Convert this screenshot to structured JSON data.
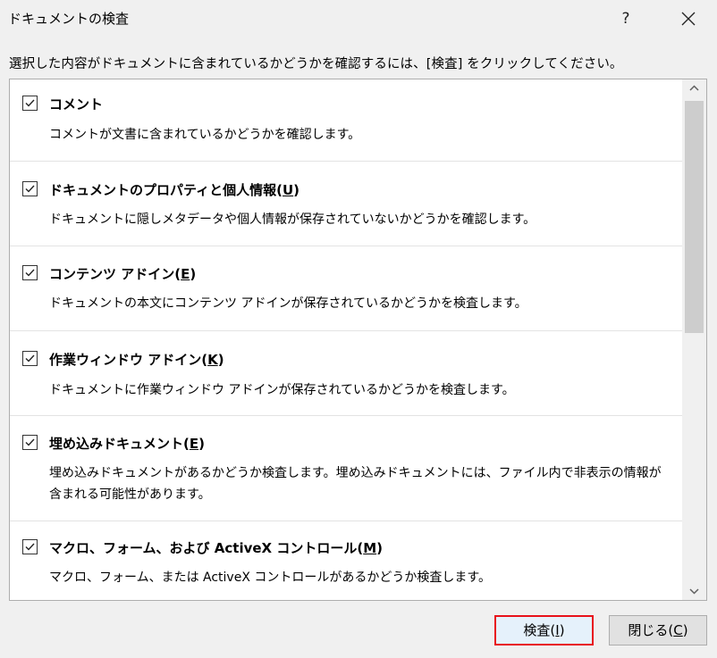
{
  "dialog": {
    "title": "ドキュメントの検査",
    "help_label": "?",
    "instruction": "選択した内容がドキュメントに含まれているかどうかを確認するには、[検査] をクリックしてください。"
  },
  "items": [
    {
      "title": "コメント",
      "accel": "",
      "checked": true,
      "desc": "コメントが文書に含まれているかどうかを確認します。"
    },
    {
      "title": "ドキュメントのプロパティと個人情報(",
      "accel": "U",
      "suffix": ")",
      "checked": true,
      "desc": "ドキュメントに隠しメタデータや個人情報が保存されていないかどうかを確認します。"
    },
    {
      "title": "コンテンツ アドイン(",
      "accel": "E",
      "suffix": ")",
      "checked": true,
      "desc": "ドキュメントの本文にコンテンツ アドインが保存されているかどうかを検査します。"
    },
    {
      "title": "作業ウィンドウ アドイン(",
      "accel": "K",
      "suffix": ")",
      "checked": true,
      "desc": "ドキュメントに作業ウィンドウ アドインが保存されているかどうかを検査します。"
    },
    {
      "title": "埋め込みドキュメント(",
      "accel": "E",
      "suffix": ")",
      "checked": true,
      "desc": "埋め込みドキュメントがあるかどうか検査します。埋め込みドキュメントには、ファイル内で非表示の情報が含まれる可能性があります。"
    },
    {
      "title": "マクロ、フォーム、および ActiveX コントロール(",
      "accel": "M",
      "suffix": ")",
      "checked": true,
      "desc": "マクロ、フォーム、または ActiveX コントロールがあるかどうか検査します。"
    }
  ],
  "buttons": {
    "inspect_label": "検査(",
    "inspect_accel": "I",
    "inspect_suffix": ")",
    "close_label": "閉じる(",
    "close_accel": "C",
    "close_suffix": ")"
  },
  "colors": {
    "highlight": "#e8111a",
    "background": "#f0f0f0"
  }
}
